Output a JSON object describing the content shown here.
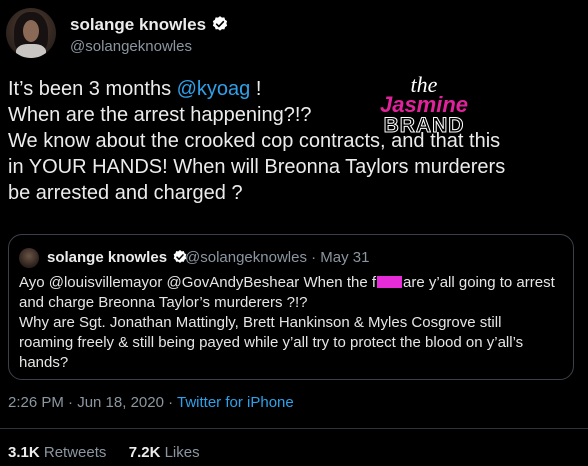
{
  "author": {
    "display_name": "solange knowles",
    "handle": "@solangeknowles"
  },
  "tweet": {
    "line1_prefix": "It’s been 3 months ",
    "line1_mention": "@kyoag",
    "line1_suffix": " !",
    "line2": "When are the arrest happening?!?",
    "line3": "We know about the crooked cop contracts, and that this",
    "line4": "in YOUR HANDS! When will Breonna Taylors murderers",
    "line5": "be arrested and charged ?"
  },
  "watermark": {
    "top": "the",
    "middle": "Jasmine",
    "bottom": "BRAND"
  },
  "quoted_tweet": {
    "display_name": "solange knowles",
    "handle_date": "@solangeknowles · May 31",
    "line1_prefix": "Ayo @louisvillemayor @GovAndyBeshear When the f",
    "line1_suffix": "are y’all going to arrest",
    "line2": "and charge Breonna Taylor’s murderers ?!?",
    "line3": "Why are Sgt. Jonathan Mattingly, Brett Hankinson & Myles Cosgrove still",
    "line4": "roaming freely & still being payed while y’all try to protect the blood on y’all’s",
    "line5": "hands?"
  },
  "meta": {
    "timestamp": "2:26 PM · Jun 18, 2020 · ",
    "source": "Twitter for iPhone"
  },
  "stats": {
    "retweets_count": "3.1K",
    "retweets_label": "Retweets",
    "likes_count": "7.2K",
    "likes_label": "Likes"
  },
  "colors": {
    "background": "#000000",
    "link": "#2ea1ea",
    "verified": "#ffffff",
    "censor_bar": "#e62bd9"
  }
}
